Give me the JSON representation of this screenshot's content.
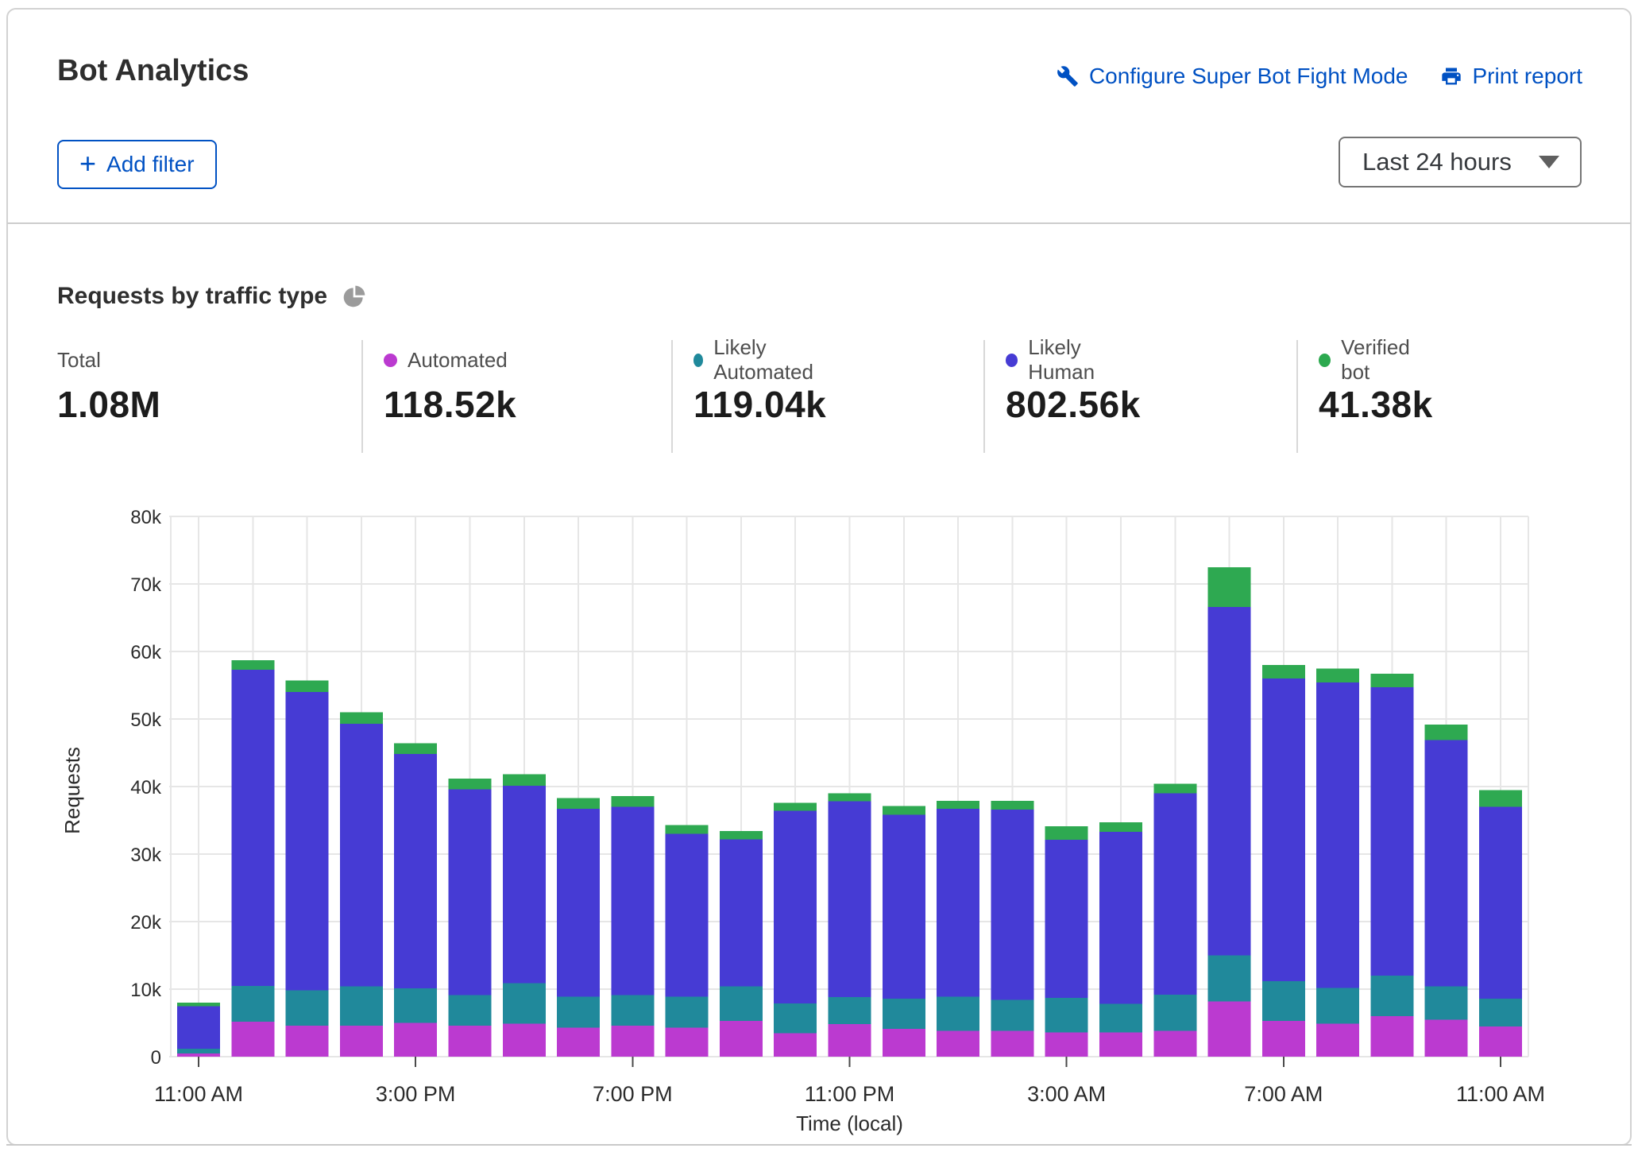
{
  "header": {
    "title": "Bot Analytics",
    "configure_link": "Configure Super Bot Fight Mode",
    "print_link": "Print report",
    "link_color": "#0051c3"
  },
  "filters": {
    "add_filter_label": "Add filter",
    "time_range_value": "Last 24 hours"
  },
  "section": {
    "title": "Requests by traffic type"
  },
  "stats": {
    "total": {
      "label": "Total",
      "value": "1.08M"
    },
    "automated": {
      "label": "Automated",
      "value": "118.52k",
      "color": "#bb3ad0"
    },
    "likely_automated": {
      "label": "Likely Automated",
      "value": "119.04k",
      "color": "#20899b"
    },
    "likely_human": {
      "label": "Likely Human",
      "value": "802.56k",
      "color": "#463bd4"
    },
    "verified_bot": {
      "label": "Verified bot",
      "value": "41.38k",
      "color": "#2ca94f"
    }
  },
  "chart_data": {
    "type": "bar",
    "stacked": true,
    "title": "Requests by traffic type",
    "xlabel": "Time (local)",
    "ylabel": "Requests",
    "ylim": [
      0,
      80000
    ],
    "bar_count": 25,
    "grid": true,
    "legend_position": "stats-row-above-chart",
    "y_ticks": [
      {
        "value": 0,
        "label": "0"
      },
      {
        "value": 10000,
        "label": "10k"
      },
      {
        "value": 20000,
        "label": "20k"
      },
      {
        "value": 30000,
        "label": "30k"
      },
      {
        "value": 40000,
        "label": "40k"
      },
      {
        "value": 50000,
        "label": "50k"
      },
      {
        "value": 60000,
        "label": "60k"
      },
      {
        "value": 70000,
        "label": "70k"
      },
      {
        "value": 80000,
        "label": "80k"
      }
    ],
    "x_ticks": [
      {
        "bar_index": 0,
        "label": "11:00 AM"
      },
      {
        "bar_index": 4,
        "label": "3:00 PM"
      },
      {
        "bar_index": 8,
        "label": "7:00 PM"
      },
      {
        "bar_index": 12,
        "label": "11:00 PM"
      },
      {
        "bar_index": 16,
        "label": "3:00 AM"
      },
      {
        "bar_index": 20,
        "label": "7:00 AM"
      },
      {
        "bar_index": 24,
        "label": "11:00 AM"
      }
    ],
    "series": [
      {
        "name": "Automated",
        "color": "#bb3ad0",
        "values": [
          500,
          5200,
          4600,
          4600,
          5000,
          4600,
          4900,
          4300,
          4600,
          4300,
          5300,
          3500,
          4800,
          4100,
          3800,
          3800,
          3600,
          3600,
          3800,
          8200,
          5300,
          4900,
          6000,
          5500,
          4500
        ]
      },
      {
        "name": "Likely Automated",
        "color": "#20899b",
        "values": [
          700,
          5300,
          5200,
          5800,
          5100,
          4500,
          6000,
          4600,
          4500,
          4600,
          5100,
          4400,
          4000,
          4500,
          5100,
          4600,
          5100,
          4200,
          5400,
          6800,
          5900,
          5300,
          6000,
          4900,
          4100
        ]
      },
      {
        "name": "Likely Human",
        "color": "#463bd4",
        "values": [
          6300,
          46800,
          44200,
          38900,
          34700,
          30500,
          29200,
          27800,
          27900,
          24100,
          21800,
          28500,
          29000,
          27200,
          27800,
          28200,
          23400,
          25500,
          29800,
          51600,
          44800,
          45200,
          42700,
          36500,
          28400
        ]
      },
      {
        "name": "Verified bot",
        "color": "#2ea951",
        "values": [
          500,
          1400,
          1700,
          1700,
          1600,
          1600,
          1700,
          1600,
          1600,
          1300,
          1200,
          1200,
          1200,
          1300,
          1200,
          1300,
          2000,
          1400,
          1400,
          5900,
          2000,
          2100,
          2000,
          2300,
          2500
        ]
      }
    ]
  }
}
